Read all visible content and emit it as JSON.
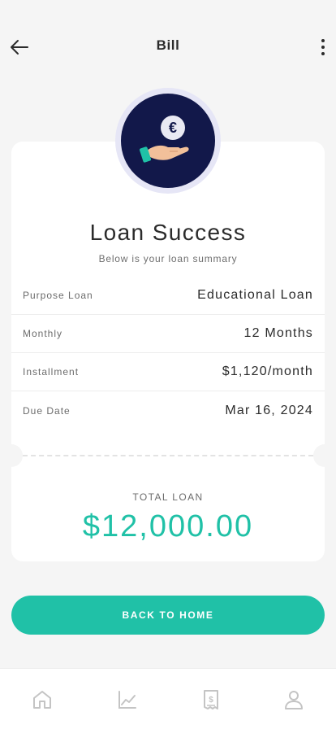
{
  "header": {
    "title": "Bill",
    "back_icon": "arrow-left-icon",
    "menu_icon": "more-vertical-icon"
  },
  "hero": {
    "icon": "hand-holding-euro-coin-icon",
    "title": "Loan Success",
    "subtitle": "Below is your loan summary"
  },
  "summary": {
    "rows": [
      {
        "label": "Purpose Loan",
        "value": "Educational Loan"
      },
      {
        "label": "Monthly",
        "value": "12 Months"
      },
      {
        "label": "Installment",
        "value": "$1,120/month"
      },
      {
        "label": "Due Date",
        "value": "Mar 16, 2024"
      }
    ]
  },
  "total": {
    "label": "TOTAL LOAN",
    "value": "$12,000.00"
  },
  "cta": {
    "label": "BACK TO HOME"
  },
  "bottom_nav": {
    "items": [
      {
        "icon": "home-icon"
      },
      {
        "icon": "chart-icon"
      },
      {
        "icon": "bill-icon"
      },
      {
        "icon": "profile-icon"
      }
    ]
  },
  "colors": {
    "accent": "#20c1a7",
    "badge_dark": "#12184a",
    "badge_ring": "#e6e6f6",
    "background": "#f5f5f5"
  }
}
